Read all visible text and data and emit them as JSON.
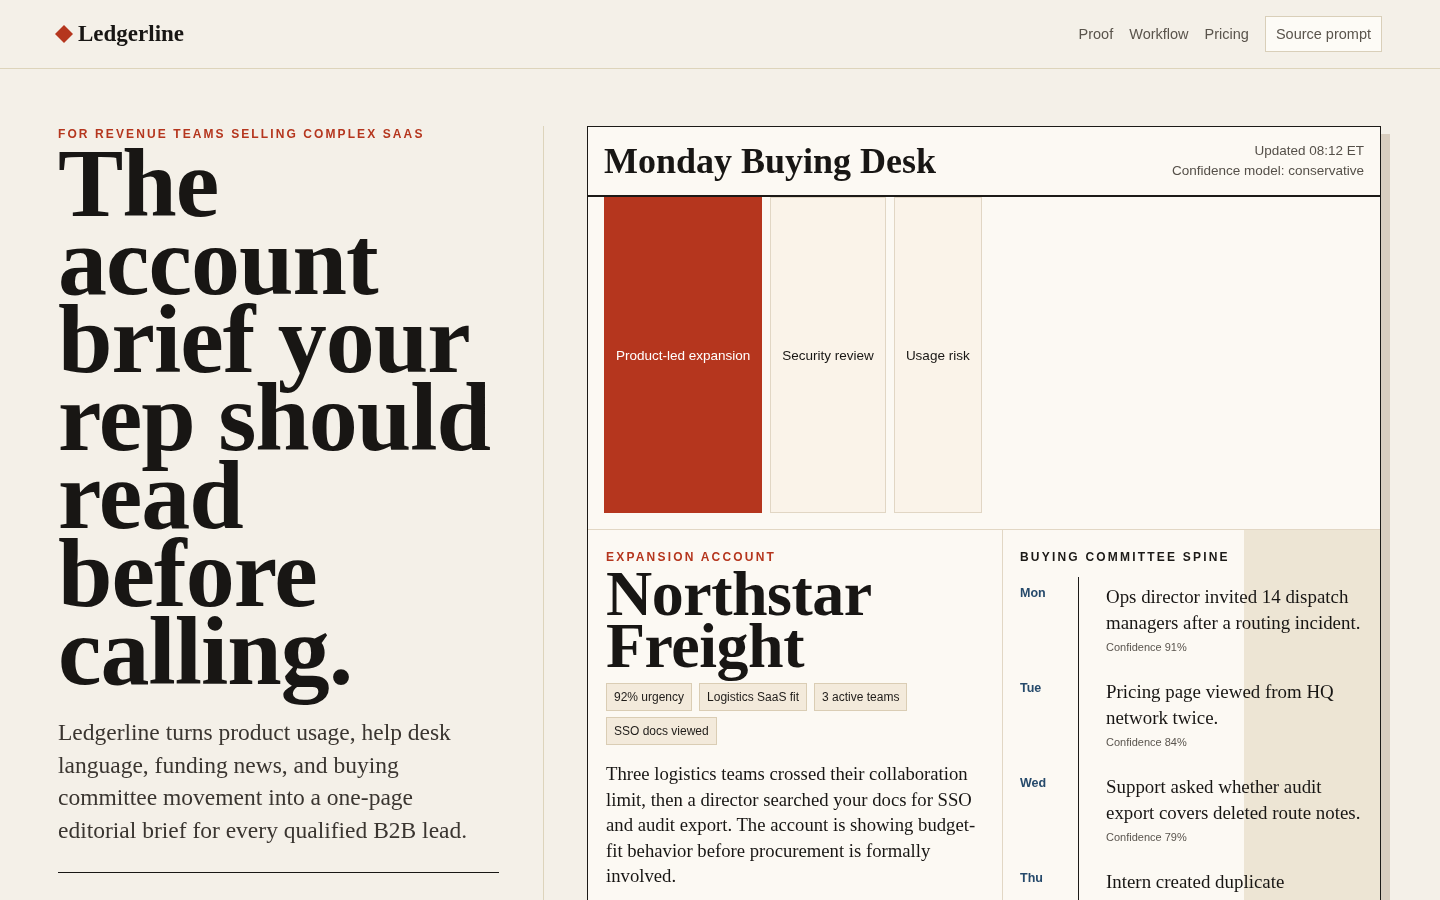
{
  "header": {
    "brand": "Ledgerline",
    "nav": [
      {
        "label": "Proof",
        "kind": "link"
      },
      {
        "label": "Workflow",
        "kind": "link"
      },
      {
        "label": "Pricing",
        "kind": "link"
      },
      {
        "label": "Source prompt",
        "kind": "button"
      }
    ]
  },
  "hero": {
    "kicker": "FOR REVENUE TEAMS SELLING COMPLEX SAAS",
    "headline": "The account brief your rep should read before calling.",
    "lede": "Ledgerline turns product usage, help desk language, funding news, and buying committee movement into a one-page editorial brief for every qualified B2B lead."
  },
  "desk": {
    "title": "Monday Buying Desk",
    "meta": [
      "Updated 08:12 ET",
      "Confidence model: conservative"
    ],
    "signals": [
      {
        "label": "Product-led expansion",
        "selected": true
      },
      {
        "label": "Security review",
        "selected": false
      },
      {
        "label": "Usage risk",
        "selected": false
      }
    ],
    "account": {
      "kicker": "EXPANSION ACCOUNT",
      "name": "Northstar Freight",
      "tags": [
        "92% urgency",
        "Logistics SaaS fit",
        "3 active teams",
        "SSO docs viewed"
      ],
      "summary": "Three logistics teams crossed their collaboration limit, then a director searched your docs for SSO and audit export. The account is showing budget-fit behavior before procurement is formally involved."
    },
    "spine": {
      "title": "BUYING COMMITTEE SPINE",
      "events": [
        {
          "day": "Mon",
          "text": "Ops director invited 14 dispatch managers after a routing incident.",
          "confidence": "Confidence 91%"
        },
        {
          "day": "Tue",
          "text": "Pricing page viewed from HQ network twice.",
          "confidence": "Confidence 84%"
        },
        {
          "day": "Wed",
          "text": "Support asked whether audit export covers deleted route notes.",
          "confidence": "Confidence 79%"
        },
        {
          "day": "Thu",
          "text": "Intern created duplicate"
        }
      ]
    }
  }
}
